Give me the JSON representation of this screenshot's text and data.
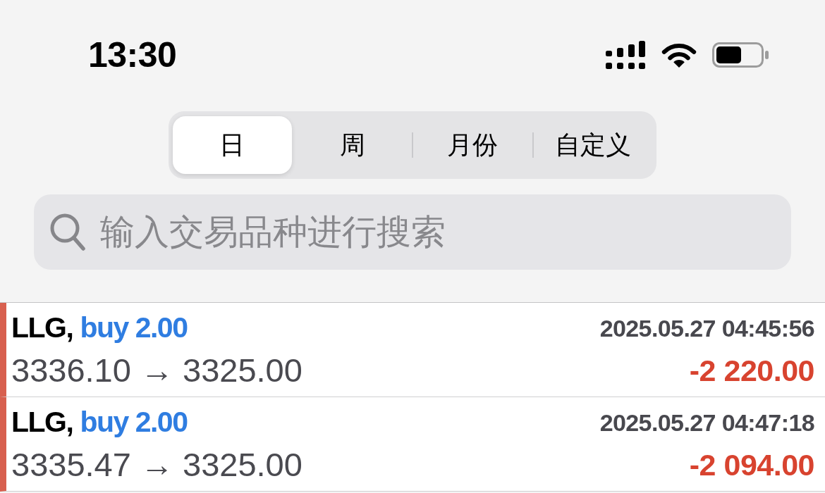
{
  "status_bar": {
    "time": "13:30"
  },
  "period_tabs": [
    {
      "label": "日",
      "selected": true
    },
    {
      "label": "周",
      "selected": false
    },
    {
      "label": "月份",
      "selected": false
    },
    {
      "label": "自定义",
      "selected": false
    }
  ],
  "search": {
    "placeholder": "输入交易品种进行搜索"
  },
  "trades": [
    {
      "symbol": "LLG,",
      "order": "buy 2.00",
      "time": "2025.05.27 04:45:56",
      "prices": "3336.10 → 3325.00",
      "profit": "-2 220.00"
    },
    {
      "symbol": "LLG,",
      "order": "buy 2.00",
      "time": "2025.05.27 04:47:18",
      "prices": "3335.47 → 3325.00",
      "profit": "-2 094.00"
    }
  ]
}
